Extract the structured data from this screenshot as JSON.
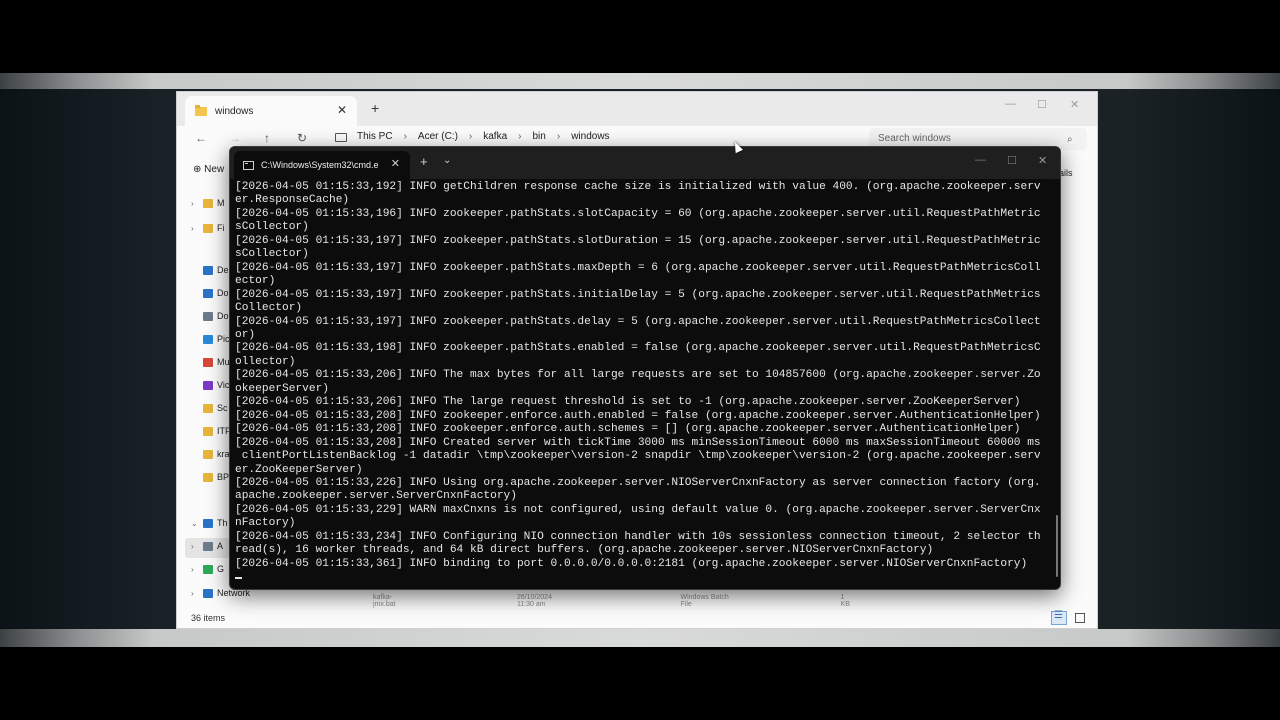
{
  "explorer": {
    "tab_title": "windows",
    "tab_close": "✕",
    "new_tab": "+",
    "min": "—",
    "max": "☐",
    "close": "✕",
    "nav": {
      "back": "←",
      "forward": "→",
      "up": "↑",
      "refresh": "↻"
    },
    "breadcrumb": [
      "This PC",
      "Acer (C:)",
      "kafka",
      "bin",
      "windows"
    ],
    "search_placeholder": "Search windows",
    "new_button": "New",
    "details_button": "ails",
    "sidebar": [
      {
        "label": "M",
        "chevron": "›",
        "color": "#e8b53c"
      },
      {
        "label": "Fi",
        "chevron": "›",
        "color": "#e8b53c"
      },
      {
        "label": "De",
        "chevron": "",
        "color": "#2a74c8"
      },
      {
        "label": "Do",
        "chevron": "",
        "color": "#2a74c8"
      },
      {
        "label": "Do",
        "chevron": "",
        "color": "#6c7c8c"
      },
      {
        "label": "Pic",
        "chevron": "",
        "color": "#2a8ad8"
      },
      {
        "label": "Mu",
        "chevron": "",
        "color": "#d8483a"
      },
      {
        "label": "Vic",
        "chevron": "",
        "color": "#7a3ac8"
      },
      {
        "label": "Sc",
        "chevron": "",
        "color": "#e8b53c"
      },
      {
        "label": "ITF",
        "chevron": "",
        "color": "#e8b53c"
      },
      {
        "label": "kra",
        "chevron": "",
        "color": "#e8b53c"
      },
      {
        "label": "BP",
        "chevron": "",
        "color": "#e8b53c"
      },
      {
        "label": "Th",
        "chevron": "⌄",
        "color": "#2a74c8"
      },
      {
        "label": "A",
        "chevron": "›",
        "color": "#6c7c8c"
      },
      {
        "label": "G",
        "chevron": "›",
        "color": "#2bab5a"
      },
      {
        "label": "Network",
        "chevron": "›",
        "color": "#2a74c8"
      }
    ],
    "ghost_file": {
      "name": "kafka-jmx.bat",
      "date": "26/10/2024 11:30 am",
      "type": "Windows Batch File",
      "size": "1 KB"
    },
    "item_count": "36 items"
  },
  "cmd": {
    "tab_title": "C:\\Windows\\System32\\cmd.e",
    "tab_close": "✕",
    "new_tab": "+",
    "dropdown": "⌄",
    "min": "—",
    "max": "☐",
    "close": "✕",
    "output": "[2026-04-05 01:15:33,192] INFO getChildren response cache size is initialized with value 400. (org.apache.zookeeper.serv\ner.ResponseCache)\n[2026-04-05 01:15:33,196] INFO zookeeper.pathStats.slotCapacity = 60 (org.apache.zookeeper.server.util.RequestPathMetric\nsCollector)\n[2026-04-05 01:15:33,197] INFO zookeeper.pathStats.slotDuration = 15 (org.apache.zookeeper.server.util.RequestPathMetric\nsCollector)\n[2026-04-05 01:15:33,197] INFO zookeeper.pathStats.maxDepth = 6 (org.apache.zookeeper.server.util.RequestPathMetricsColl\nector)\n[2026-04-05 01:15:33,197] INFO zookeeper.pathStats.initialDelay = 5 (org.apache.zookeeper.server.util.RequestPathMetrics\nCollector)\n[2026-04-05 01:15:33,197] INFO zookeeper.pathStats.delay = 5 (org.apache.zookeeper.server.util.RequestPathMetricsCollect\nor)\n[2026-04-05 01:15:33,198] INFO zookeeper.pathStats.enabled = false (org.apache.zookeeper.server.util.RequestPathMetricsC\nollector)\n[2026-04-05 01:15:33,206] INFO The max bytes for all large requests are set to 104857600 (org.apache.zookeeper.server.Zo\nokeeperServer)\n[2026-04-05 01:15:33,206] INFO The large request threshold is set to -1 (org.apache.zookeeper.server.ZooKeeperServer)\n[2026-04-05 01:15:33,208] INFO zookeeper.enforce.auth.enabled = false (org.apache.zookeeper.server.AuthenticationHelper)\n[2026-04-05 01:15:33,208] INFO zookeeper.enforce.auth.schemes = [] (org.apache.zookeeper.server.AuthenticationHelper)\n[2026-04-05 01:15:33,208] INFO Created server with tickTime 3000 ms minSessionTimeout 6000 ms maxSessionTimeout 60000 ms\n clientPortListenBacklog -1 datadir \\tmp\\zookeeper\\version-2 snapdir \\tmp\\zookeeper\\version-2 (org.apache.zookeeper.serv\ner.ZooKeeperServer)\n[2026-04-05 01:15:33,226] INFO Using org.apache.zookeeper.server.NIOServerCnxnFactory as server connection factory (org.\napache.zookeeper.server.ServerCnxnFactory)\n[2026-04-05 01:15:33,229] WARN maxCnxns is not configured, using default value 0. (org.apache.zookeeper.server.ServerCnx\nnFactory)\n[2026-04-05 01:15:33,234] INFO Configuring NIO connection handler with 10s sessionless connection timeout, 2 selector th\nread(s), 16 worker threads, and 64 kB direct buffers. (org.apache.zookeeper.server.NIOServerCnxnFactory)\n[2026-04-05 01:15:33,361] INFO binding to port 0.0.0.0/0.0.0.0:2181 (org.apache.zookeeper.server.NIOServerCnxnFactory)"
  }
}
